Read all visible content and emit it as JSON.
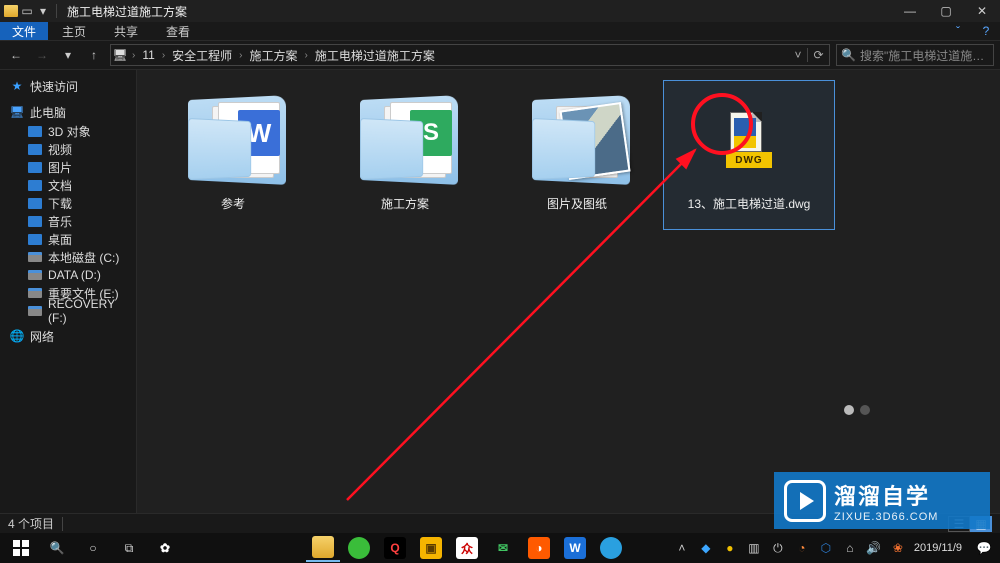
{
  "titlebar": {
    "title": "施工电梯过道施工方案"
  },
  "menutabs": {
    "file": "文件",
    "home": "主页",
    "share": "共享",
    "view": "查看"
  },
  "breadcrumb": {
    "segs": [
      "11",
      "安全工程师",
      "施工方案",
      "施工电梯过道施工方案"
    ]
  },
  "search": {
    "placeholder": "搜索\"施工电梯过道施工方案\""
  },
  "sidebar": {
    "quick": "快速访问",
    "thispc": "此电脑",
    "items": [
      "3D 对象",
      "视频",
      "图片",
      "文档",
      "下载",
      "音乐",
      "桌面"
    ],
    "drives": [
      "本地磁盘 (C:)",
      "DATA (D:)",
      "重要文件 (E:)",
      "RECOVERY (F:)"
    ],
    "network": "网络"
  },
  "tiles": [
    {
      "label": "参考",
      "kind": "folder-word"
    },
    {
      "label": "施工方案",
      "kind": "folder-sheet"
    },
    {
      "label": "图片及图纸",
      "kind": "folder-photo"
    },
    {
      "label": "13、施工电梯过道.dwg",
      "kind": "dwg",
      "selected": true
    }
  ],
  "status": {
    "count": "4 个项目"
  },
  "dwg_badge": "DWG",
  "watermark": {
    "line1": "溜溜自学",
    "line2": "ZIXUE.3D66.COM"
  },
  "clock": {
    "time": "",
    "date": "2019/11/9"
  }
}
